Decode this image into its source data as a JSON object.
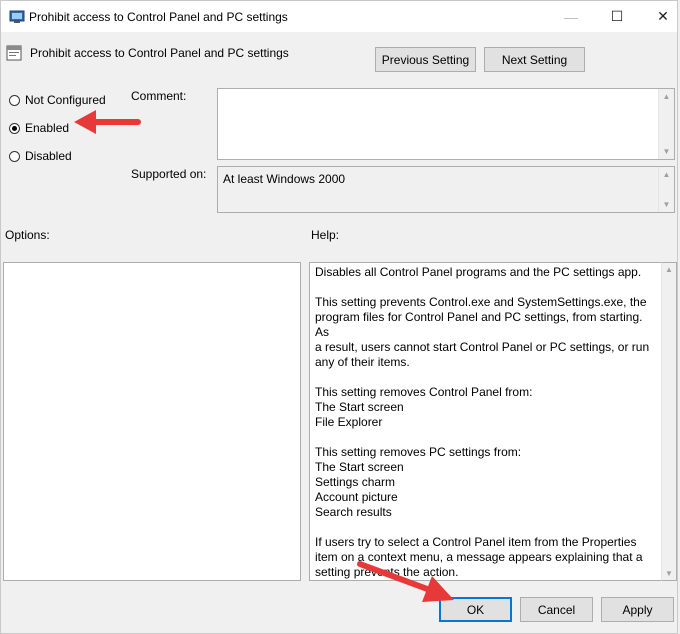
{
  "window": {
    "title": "Prohibit access to Control Panel and PC settings",
    "controls": {
      "minimize": "—",
      "maximize": "☐",
      "close": "✕"
    }
  },
  "header": {
    "setting_name": "Prohibit access to Control Panel and PC settings",
    "previous_button": "Previous Setting",
    "next_button": "Next Setting"
  },
  "state": {
    "options": [
      "Not Configured",
      "Enabled",
      "Disabled"
    ],
    "selected": "Enabled"
  },
  "comment": {
    "label": "Comment:",
    "value": ""
  },
  "supported": {
    "label": "Supported on:",
    "value": "At least Windows 2000"
  },
  "options_label": "Options:",
  "help": {
    "label": "Help:",
    "p1": "Disables all Control Panel programs and the PC settings app.",
    "p2": [
      "This setting prevents Control.exe and SystemSettings.exe, the",
      "program files for Control Panel and PC settings, from starting. As",
      "a result, users cannot start Control Panel or PC settings, or run",
      "any of their items."
    ],
    "p3": [
      "This setting removes Control Panel from:",
      "The Start screen",
      "File Explorer"
    ],
    "p4": [
      "This setting removes PC settings from:",
      "The Start screen",
      "Settings charm",
      "Account picture",
      "Search results"
    ],
    "p5": [
      "If users try to select a Control Panel item from the Properties",
      "item on a context menu, a message appears explaining that a",
      "setting prevents the action."
    ]
  },
  "footer": {
    "ok": "OK",
    "cancel": "Cancel",
    "apply": "Apply"
  },
  "annotation_color": "#e8393a"
}
